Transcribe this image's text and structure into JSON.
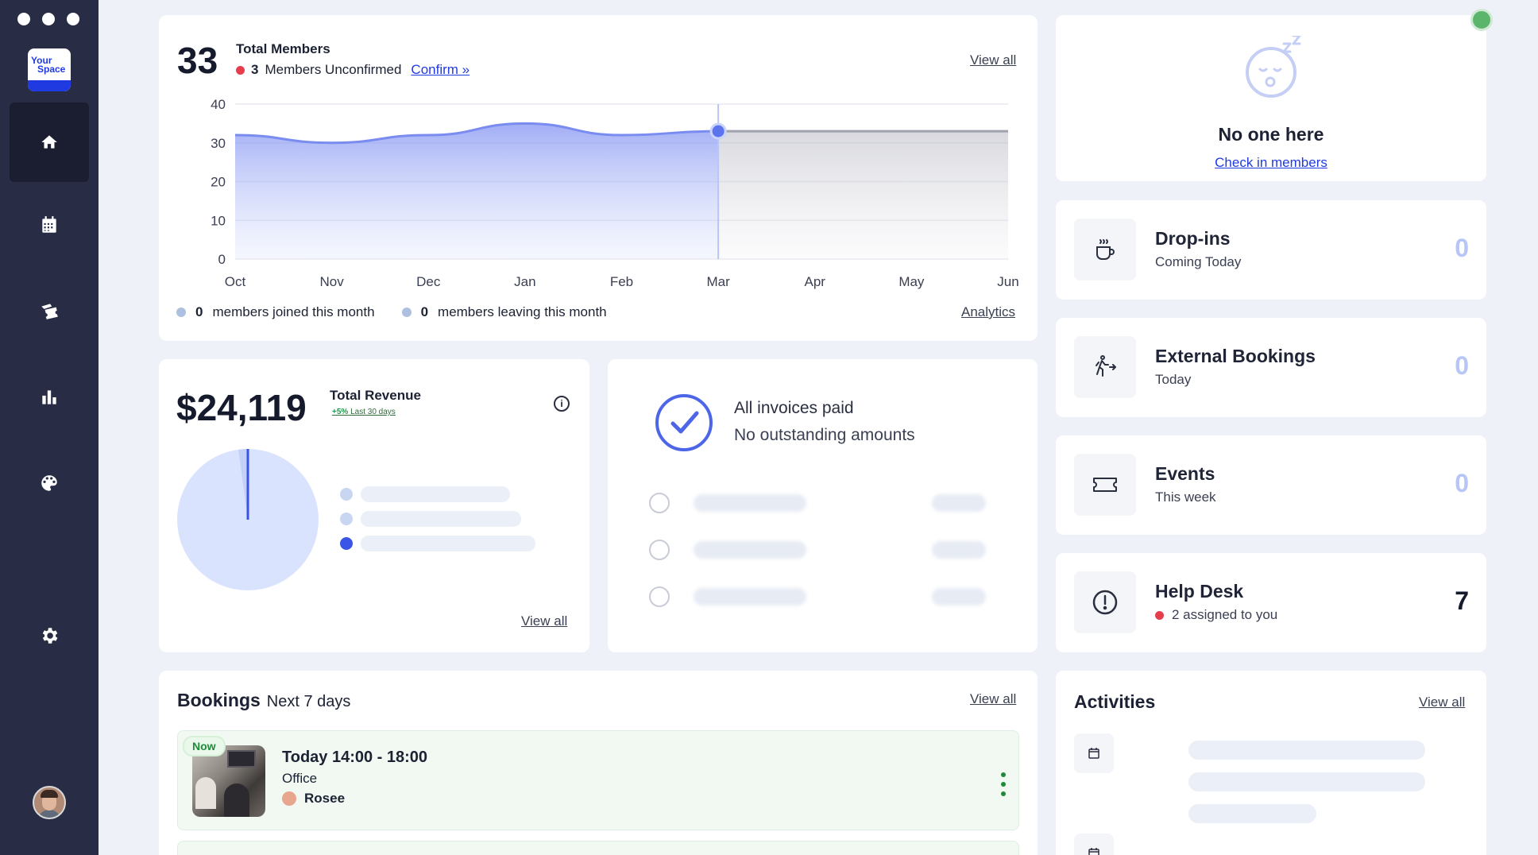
{
  "sidebar": {
    "logo_line1": "Your",
    "logo_line2": "Space",
    "items": [
      {
        "name": "home",
        "active": true
      },
      {
        "name": "calendar"
      },
      {
        "name": "tickets"
      },
      {
        "name": "analytics"
      },
      {
        "name": "palette"
      },
      {
        "name": "settings"
      }
    ]
  },
  "members": {
    "count": "33",
    "title": "Total Members",
    "unconfirmed_count": "3",
    "unconfirmed_label": "Members Unconfirmed",
    "confirm_link": "Confirm »",
    "view_all": "View all",
    "joined_count": "0",
    "joined_label": "members joined this month",
    "leaving_count": "0",
    "leaving_label": "members leaving this month",
    "analytics_link": "Analytics"
  },
  "chart_data": {
    "type": "area",
    "categories": [
      "Oct",
      "Nov",
      "Dec",
      "Jan",
      "Feb",
      "Mar",
      "Apr",
      "May",
      "Jun"
    ],
    "values": [
      32,
      30,
      32,
      35,
      32,
      33,
      33,
      33,
      33
    ],
    "projected_from": "Mar",
    "yticks": [
      0,
      10,
      20,
      30,
      40
    ],
    "ylim": [
      0,
      40
    ],
    "grid": true,
    "colors": {
      "actual": "#7b8cf0",
      "projected": "#a0a3ad",
      "marker": "#5b74ee"
    }
  },
  "revenue": {
    "amount": "$24,119",
    "title": "Total Revenue",
    "change": "+5%",
    "change_period": "Last 30 days",
    "info_icon": "info-icon",
    "view_all": "View all"
  },
  "invoices": {
    "heading": "All invoices paid",
    "subheading": "No outstanding amounts"
  },
  "bookings": {
    "title": "Bookings",
    "period": "Next 7 days",
    "view_all": "View all",
    "items": [
      {
        "badge": "Now",
        "time": "Today 14:00 - 18:00",
        "place": "Office",
        "person": "Rosee"
      }
    ]
  },
  "presence": {
    "heading": "No one here",
    "link": "Check in members"
  },
  "stats": [
    {
      "title": "Drop-ins",
      "subtitle": "Coming Today",
      "value": "0",
      "icon": "coffee-cup-icon"
    },
    {
      "title": "External Bookings",
      "subtitle": "Today",
      "value": "0",
      "icon": "walking-person-icon"
    },
    {
      "title": "Events",
      "subtitle": "This week",
      "value": "0",
      "icon": "ticket-icon"
    },
    {
      "title": "Help Desk",
      "subtitle": "2 assigned to you",
      "value": "7",
      "icon": "alert-circle-icon"
    }
  ],
  "activities": {
    "title": "Activities",
    "view_all": "View all"
  },
  "colors": {
    "sidebar_bg": "#282d45",
    "accent": "#1f3ae0",
    "success": "#1f8a3a",
    "alert": "#e63d4c"
  }
}
